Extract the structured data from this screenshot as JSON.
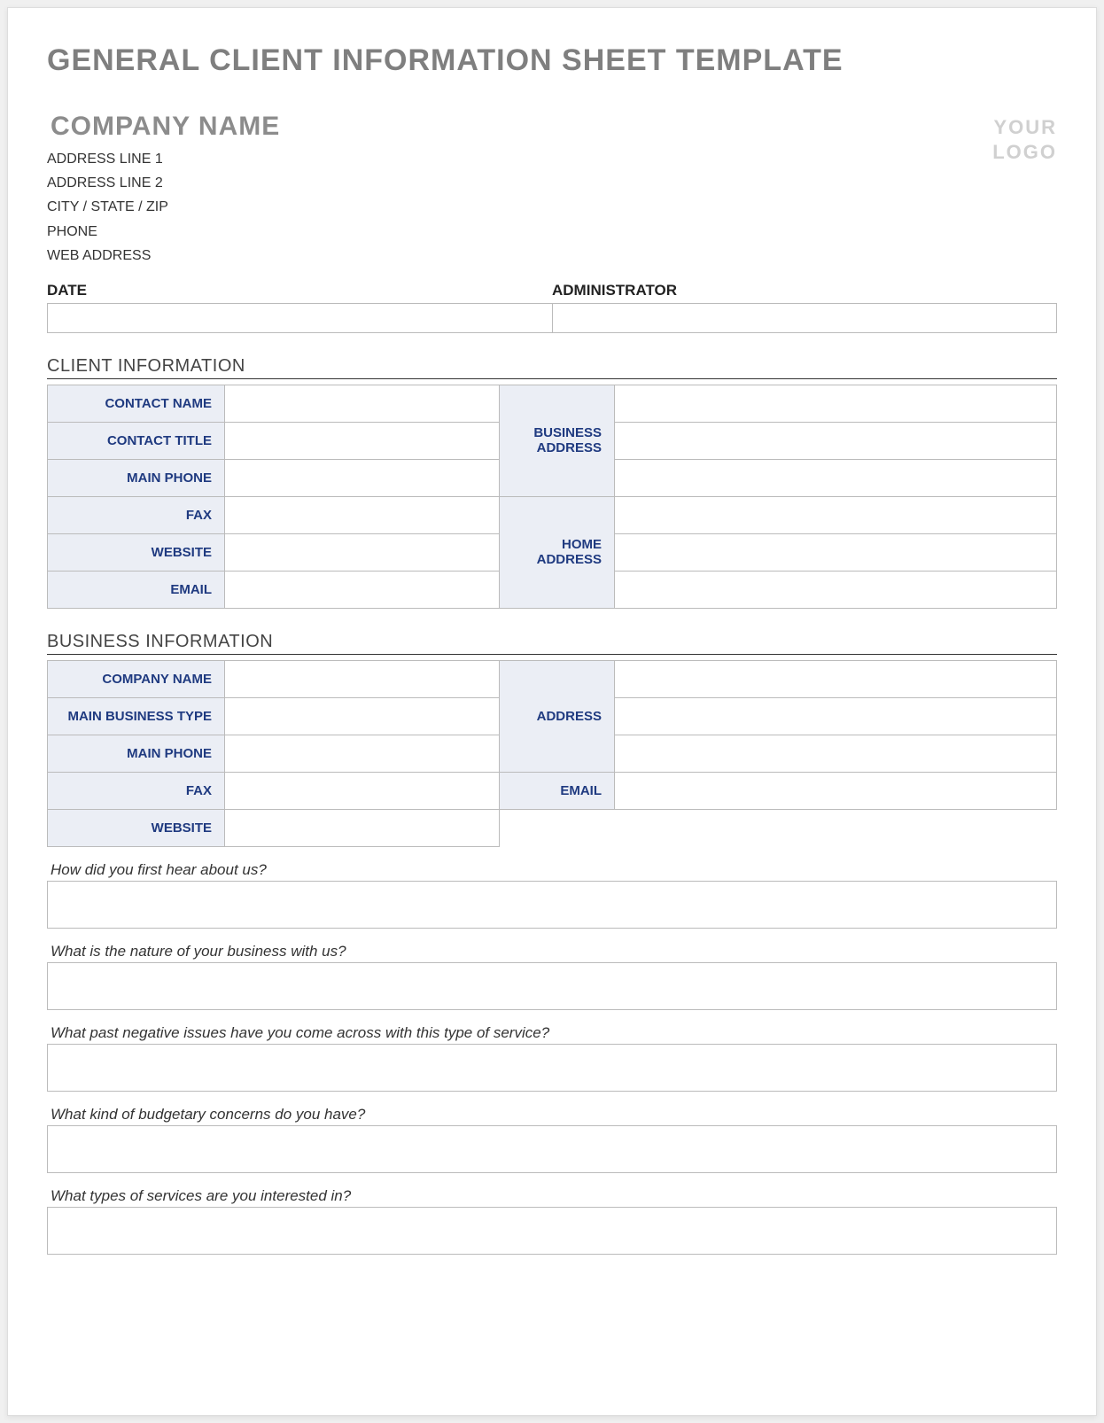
{
  "title": "GENERAL CLIENT INFORMATION SHEET TEMPLATE",
  "company": {
    "name": "COMPANY NAME",
    "addr1": "ADDRESS LINE 1",
    "addr2": "ADDRESS LINE 2",
    "citystatezip": "CITY / STATE / ZIP",
    "phone": "PHONE",
    "web": "WEB ADDRESS"
  },
  "logo": {
    "line1": "YOUR",
    "line2": "LOGO"
  },
  "meta": {
    "date_label": "DATE",
    "admin_label": "ADMINISTRATOR"
  },
  "client_section": "CLIENT INFORMATION",
  "client": {
    "contact_name": "CONTACT NAME",
    "contact_title": "CONTACT TITLE",
    "main_phone": "MAIN PHONE",
    "fax": "FAX",
    "website": "WEBSITE",
    "email": "EMAIL",
    "business_address": "BUSINESS ADDRESS",
    "home_address": "HOME ADDRESS"
  },
  "business_section": "BUSINESS INFORMATION",
  "business": {
    "company_name": "COMPANY NAME",
    "main_biz_type": "MAIN BUSINESS TYPE",
    "main_phone": "MAIN PHONE",
    "fax": "FAX",
    "website": "WEBSITE",
    "address": "ADDRESS",
    "email": "EMAIL"
  },
  "q": {
    "q1": "How did you first hear about us?",
    "q2": "What is the nature of your business with us?",
    "q3": "What past negative issues have you come across with this type of service?",
    "q4": "What kind of budgetary concerns do you have?",
    "q5": "What types of services are you interested in?"
  }
}
